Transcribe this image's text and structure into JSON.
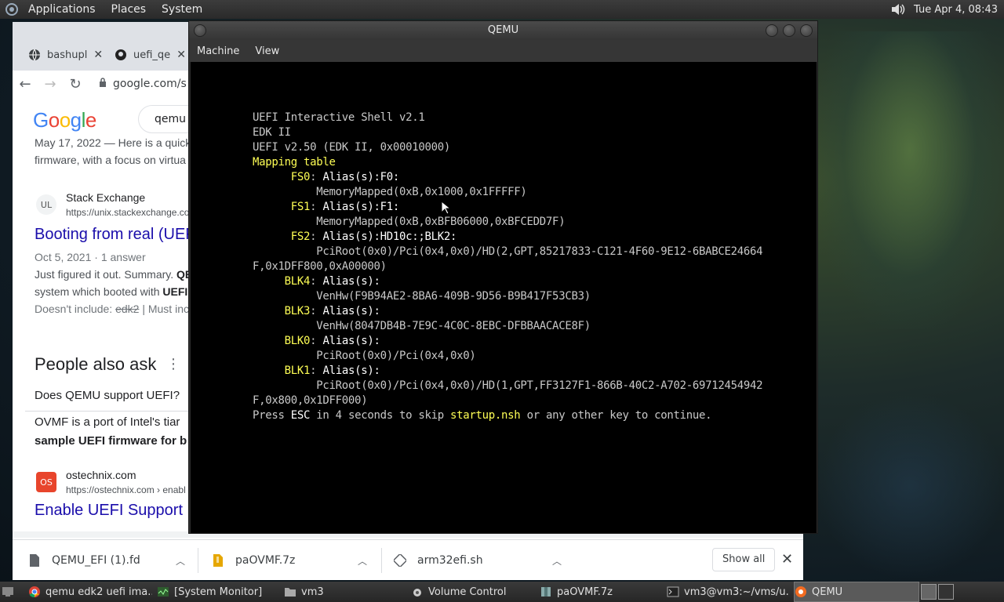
{
  "top_panel": {
    "menus": [
      "Applications",
      "Places",
      "System"
    ],
    "datetime": "Tue Apr  4, 08:43"
  },
  "browser": {
    "tabs": [
      {
        "label": "bashupl",
        "icon": "globe-icon"
      },
      {
        "label": "uefi_qe",
        "icon": "github-icon"
      }
    ],
    "url": "google.com/s",
    "search_query": "qemu e",
    "results": [
      {
        "date_snippet": "May 17, 2022 — Here is a quick",
        "snippet2": "firmware, with a focus on virtua"
      },
      {
        "site": "Stack Exchange",
        "url": "https://unix.stackexchange.co",
        "title": "Booting from real (UEF",
        "meta": "Oct 5, 2021 · 1 answer",
        "s1a": "Just figured it out. Summary. ",
        "s1b": "QE",
        "s2a": "system which booted with ",
        "s2b": "UEFI",
        "s3a": "Doesn't include: ",
        "s3b": "edk2",
        "s3c": " | Must inc"
      },
      {
        "site": "ostechnix.com",
        "url": "https://ostechnix.com › enabl",
        "title": "Enable UEFI Support F"
      }
    ],
    "paa": {
      "heading": "People also ask",
      "question": "Does QEMU support UEFI?",
      "answer1": "OVMF is a port of Intel's tiar",
      "answer2": "sample UEFI firmware for b"
    },
    "downloads": [
      {
        "name": "QEMU_EFI (1).fd",
        "icon": "file-icon"
      },
      {
        "name": "paOVMF.7z",
        "icon": "archive-icon"
      },
      {
        "name": "arm32efi.sh",
        "icon": "script-icon"
      }
    ],
    "show_all": "Show all"
  },
  "qemu": {
    "title": "QEMU",
    "menu": [
      "Machine",
      "View"
    ],
    "lines": {
      "l1": "UEFI Interactive Shell v2.1",
      "l2": "EDK II",
      "l3": "UEFI v2.50 (EDK II, 0x00010000)",
      "l4": "Mapping table",
      "fs0": "FS0",
      "fs0_alias": "Alias(s):F0:",
      "fs0_path": "MemoryMapped(0xB,0x1000,0x1FFFFF)",
      "fs1": "FS1",
      "fs1_alias": "Alias(s):F1:",
      "fs1_path": "MemoryMapped(0xB,0xBFB06000,0xBFCEDD7F)",
      "fs2": "FS2",
      "fs2_alias": "Alias(s):HD10c:;BLK2:",
      "fs2_path": "PciRoot(0x0)/Pci(0x4,0x0)/HD(2,GPT,85217833-C121-4F60-9E12-6BABCE24664",
      "fs2_path2": "F,0x1DFF800,0xA00000)",
      "blk4": "BLK4",
      "blk4_alias": "Alias(s):",
      "blk4_path": "VenHw(F9B94AE2-8BA6-409B-9D56-B9B417F53CB3)",
      "blk3": "BLK3",
      "blk3_alias": "Alias(s):",
      "blk3_path": "VenHw(8047DB4B-7E9C-4C0C-8EBC-DFBBAACACE8F)",
      "blk0": "BLK0",
      "blk0_alias": "Alias(s):",
      "blk0_path": "PciRoot(0x0)/Pci(0x4,0x0)",
      "blk1": "BLK1",
      "blk1_alias": "Alias(s):",
      "blk1_path": "PciRoot(0x0)/Pci(0x4,0x0)/HD(1,GPT,FF3127F1-866B-40C2-A702-69712454942",
      "blk1_path2": "F,0x800,0x1DFF000)",
      "press_a": "Press ",
      "press_esc": "ESC",
      "press_b": " in 4 seconds to skip ",
      "press_file": "startup.nsh",
      "press_c": " or any other key to continue."
    }
  },
  "taskbar": [
    {
      "label": "qemu edk2 uefi ima...",
      "icon": "chrome-icon"
    },
    {
      "label": "[System Monitor]",
      "icon": "monitor-icon"
    },
    {
      "label": "vm3",
      "icon": "folder-icon"
    },
    {
      "label": "Volume Control",
      "icon": "speaker-icon"
    },
    {
      "label": "paOVMF.7z",
      "icon": "archive-icon"
    },
    {
      "label": "vm3@vm3:~/vms/u...",
      "icon": "terminal-icon"
    },
    {
      "label": "QEMU",
      "icon": "qemu-icon"
    }
  ]
}
